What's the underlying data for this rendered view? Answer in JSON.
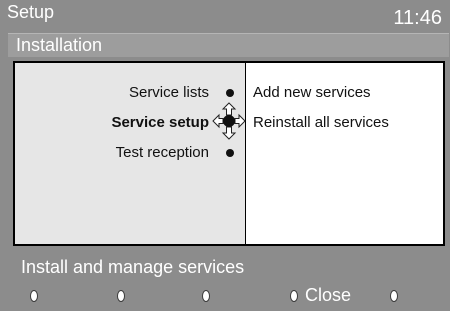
{
  "header": {
    "title": "Setup",
    "clock": "11:46"
  },
  "section": {
    "title": "Installation"
  },
  "menu": {
    "items": [
      {
        "label": "Service lists",
        "selected": false
      },
      {
        "label": "Service setup",
        "selected": true
      },
      {
        "label": "Test reception",
        "selected": false
      }
    ]
  },
  "submenu": {
    "options": [
      {
        "label": "Add new services"
      },
      {
        "label": "Reinstall all services"
      }
    ]
  },
  "status": {
    "text": "Install and manage services"
  },
  "footer": {
    "keys": [
      {
        "label": ""
      },
      {
        "label": ""
      },
      {
        "label": ""
      },
      {
        "label": "Close"
      },
      {
        "label": ""
      }
    ]
  }
}
